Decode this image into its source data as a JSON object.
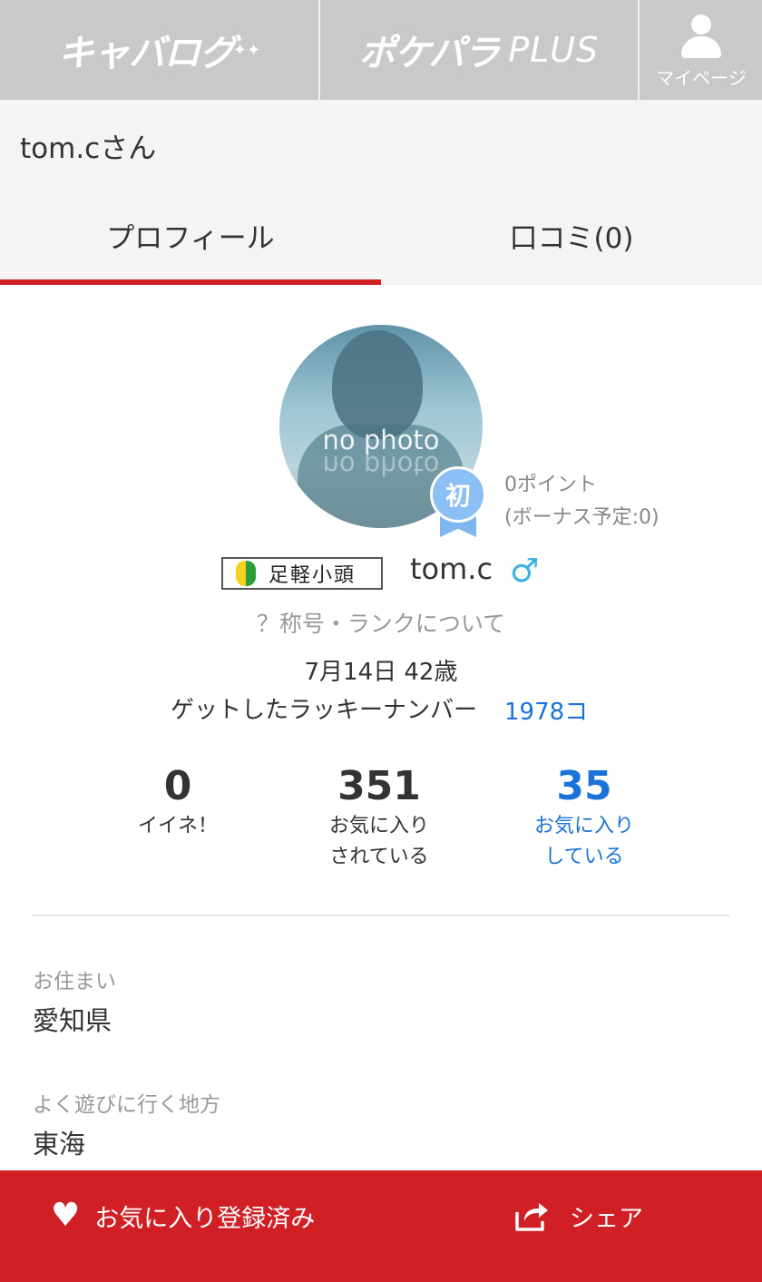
{
  "nav": {
    "logo1": "キャバログ",
    "logo2": "ポケパラ",
    "logo2_suffix": "PLUS",
    "mypage_label": "マイページ"
  },
  "header": {
    "title": "tom.cさん"
  },
  "tabs": {
    "profile": "プロフィール",
    "reviews": "口コミ(0)"
  },
  "avatar": {
    "placeholder_text": "no photo",
    "badge": "初"
  },
  "points": {
    "current": "0ポイント",
    "bonus": "(ボーナス予定:0)"
  },
  "user": {
    "rank_title": "足軽小頭",
    "name": "tom.c",
    "gender_symbol": "♂",
    "rank_link": "？称号・ランクについて",
    "birthday_age": "7月14日 42歳",
    "lucky_label": "ゲットしたラッキーナンバー",
    "lucky_count": "1978コ"
  },
  "stats": {
    "likes": {
      "value": "0",
      "label": "イイネ！"
    },
    "favorited_by": {
      "value": "351",
      "label": "お気に入り\nされている"
    },
    "favoriting": {
      "value": "35",
      "label": "お気に入り\nしている"
    }
  },
  "fields": {
    "residence_label": "お住まい",
    "residence_value": "愛知県",
    "area_label": "よく遊びに行く地方",
    "area_value": "東海"
  },
  "bottom": {
    "favorite_label": "お気に入り登録済み",
    "share_label": "シェア"
  },
  "colors": {
    "accent_red": "#d01f25",
    "link_blue": "#1a73d8",
    "nav_gray": "#c9c9c9"
  }
}
